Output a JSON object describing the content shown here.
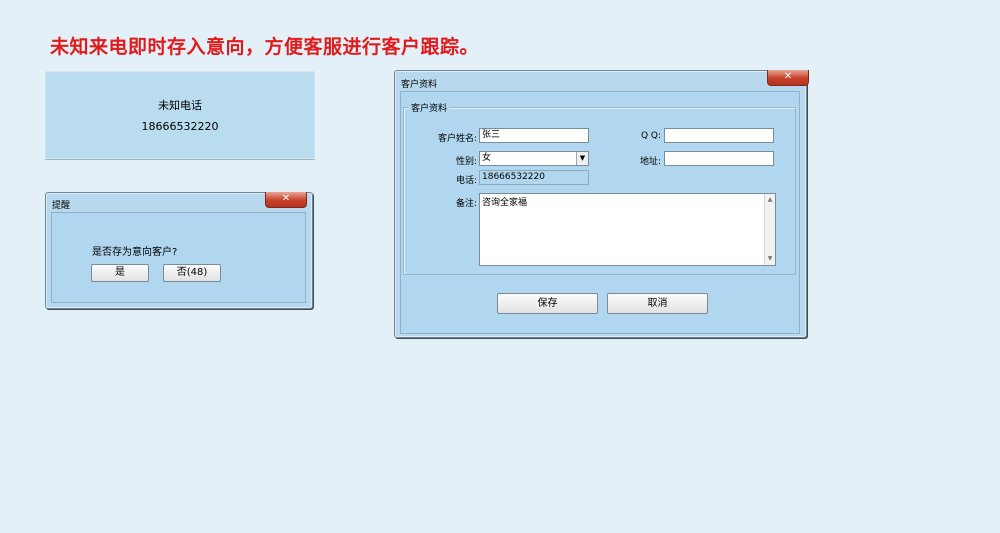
{
  "headline": "未知来电即时存入意向，方便客服进行客户跟踪。",
  "call_panel": {
    "label": "未知电话",
    "number": "18666532220"
  },
  "reminder_dialog": {
    "title": "提醒",
    "close_icon": "x-icon",
    "close_glyph": "✕",
    "question": "是否存为意向客户?",
    "yes_label": "是",
    "no_label": "否(48)"
  },
  "customer_dialog": {
    "title": "客户资料",
    "close_icon": "x-icon",
    "close_glyph": "✕",
    "group_label": "客户资料",
    "name_label": "客户姓名:",
    "name_value": "张三",
    "qq_label": "Q Q:",
    "qq_value": "",
    "gender_label": "性别:",
    "gender_value": "女",
    "gender_arrow_glyph": "▼",
    "address_label": "地址:",
    "address_value": "",
    "phone_label": "电话:",
    "phone_value": "18666532220",
    "notes_label": "备注:",
    "notes_value": "咨询全家福",
    "scroll_up_glyph": "▲",
    "scroll_down_glyph": "▼",
    "save_label": "保存",
    "cancel_label": "取消"
  },
  "colors": {
    "headline": "#e11b1b",
    "background": "#e3f0f8",
    "panel": "#b9dcef",
    "close_button": "#c7412b"
  }
}
